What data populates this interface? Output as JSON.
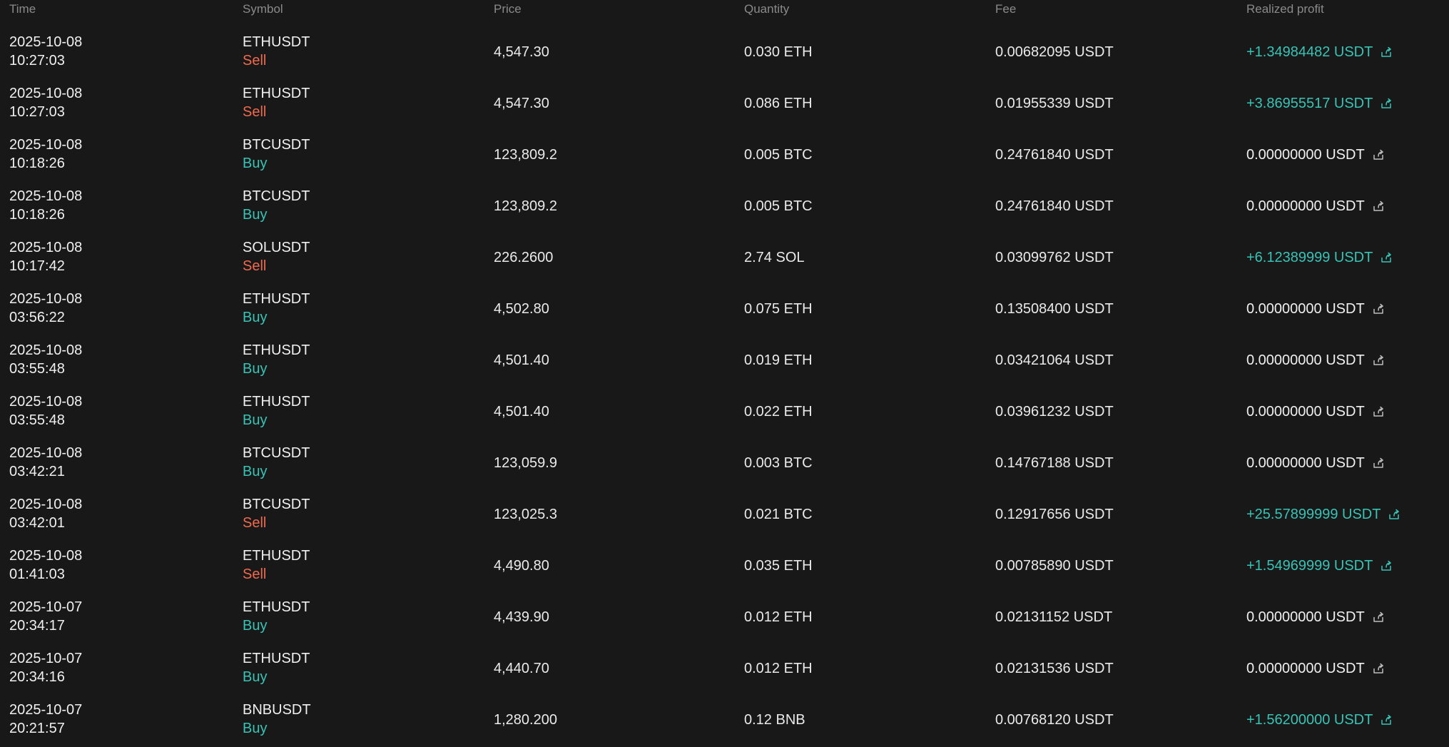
{
  "header": {
    "time": "Time",
    "symbol": "Symbol",
    "price": "Price",
    "quantity": "Quantity",
    "fee": "Fee",
    "realized_profit": "Realized profit"
  },
  "colors": {
    "background": "#181818",
    "sell": "#ef6a4e",
    "buy": "#39c3b5",
    "profit_positive": "#39c3b5",
    "header_text": "#8a8a8a"
  },
  "rows": [
    {
      "date": "2025-10-08",
      "time": "10:27:03",
      "symbol": "ETHUSDT",
      "side": "Sell",
      "price": "4,547.30",
      "quantity": "0.030 ETH",
      "fee": "0.00682095 USDT",
      "profit": "+1.34984482 USDT"
    },
    {
      "date": "2025-10-08",
      "time": "10:27:03",
      "symbol": "ETHUSDT",
      "side": "Sell",
      "price": "4,547.30",
      "quantity": "0.086 ETH",
      "fee": "0.01955339 USDT",
      "profit": "+3.86955517 USDT"
    },
    {
      "date": "2025-10-08",
      "time": "10:18:26",
      "symbol": "BTCUSDT",
      "side": "Buy",
      "price": "123,809.2",
      "quantity": "0.005 BTC",
      "fee": "0.24761840 USDT",
      "profit": "0.00000000 USDT"
    },
    {
      "date": "2025-10-08",
      "time": "10:18:26",
      "symbol": "BTCUSDT",
      "side": "Buy",
      "price": "123,809.2",
      "quantity": "0.005 BTC",
      "fee": "0.24761840 USDT",
      "profit": "0.00000000 USDT"
    },
    {
      "date": "2025-10-08",
      "time": "10:17:42",
      "symbol": "SOLUSDT",
      "side": "Sell",
      "price": "226.2600",
      "quantity": "2.74 SOL",
      "fee": "0.03099762 USDT",
      "profit": "+6.12389999 USDT"
    },
    {
      "date": "2025-10-08",
      "time": "03:56:22",
      "symbol": "ETHUSDT",
      "side": "Buy",
      "price": "4,502.80",
      "quantity": "0.075 ETH",
      "fee": "0.13508400 USDT",
      "profit": "0.00000000 USDT"
    },
    {
      "date": "2025-10-08",
      "time": "03:55:48",
      "symbol": "ETHUSDT",
      "side": "Buy",
      "price": "4,501.40",
      "quantity": "0.019 ETH",
      "fee": "0.03421064 USDT",
      "profit": "0.00000000 USDT"
    },
    {
      "date": "2025-10-08",
      "time": "03:55:48",
      "symbol": "ETHUSDT",
      "side": "Buy",
      "price": "4,501.40",
      "quantity": "0.022 ETH",
      "fee": "0.03961232 USDT",
      "profit": "0.00000000 USDT"
    },
    {
      "date": "2025-10-08",
      "time": "03:42:21",
      "symbol": "BTCUSDT",
      "side": "Buy",
      "price": "123,059.9",
      "quantity": "0.003 BTC",
      "fee": "0.14767188 USDT",
      "profit": "0.00000000 USDT"
    },
    {
      "date": "2025-10-08",
      "time": "03:42:01",
      "symbol": "BTCUSDT",
      "side": "Sell",
      "price": "123,025.3",
      "quantity": "0.021 BTC",
      "fee": "0.12917656 USDT",
      "profit": "+25.57899999 USDT"
    },
    {
      "date": "2025-10-08",
      "time": "01:41:03",
      "symbol": "ETHUSDT",
      "side": "Sell",
      "price": "4,490.80",
      "quantity": "0.035 ETH",
      "fee": "0.00785890 USDT",
      "profit": "+1.54969999 USDT"
    },
    {
      "date": "2025-10-07",
      "time": "20:34:17",
      "symbol": "ETHUSDT",
      "side": "Buy",
      "price": "4,439.90",
      "quantity": "0.012 ETH",
      "fee": "0.02131152 USDT",
      "profit": "0.00000000 USDT"
    },
    {
      "date": "2025-10-07",
      "time": "20:34:16",
      "symbol": "ETHUSDT",
      "side": "Buy",
      "price": "4,440.70",
      "quantity": "0.012 ETH",
      "fee": "0.02131536 USDT",
      "profit": "0.00000000 USDT"
    },
    {
      "date": "2025-10-07",
      "time": "20:21:57",
      "symbol": "BNBUSDT",
      "side": "Buy",
      "price": "1,280.200",
      "quantity": "0.12 BNB",
      "fee": "0.00768120 USDT",
      "profit": "+1.56200000 USDT"
    }
  ],
  "icons": {
    "share": "share-icon"
  }
}
